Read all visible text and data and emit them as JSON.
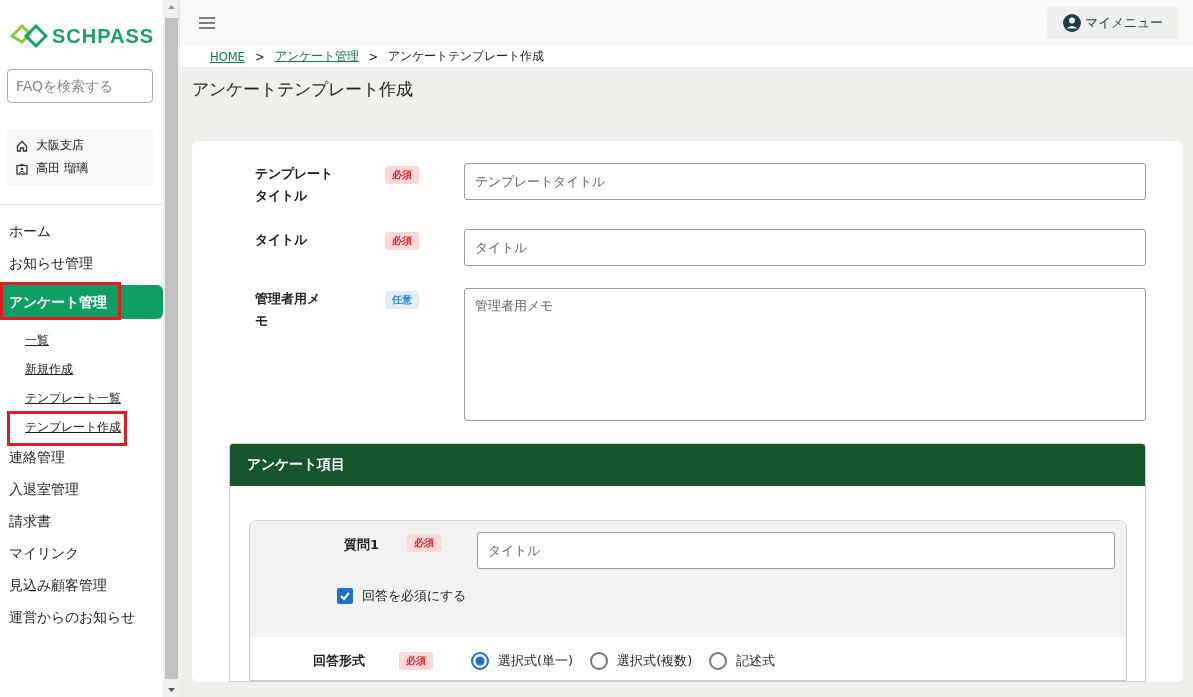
{
  "sidebar": {
    "logo": "SCHPASS",
    "search": {
      "placeholder": "FAQを検索する"
    },
    "user": {
      "branch": "大阪支店",
      "name": "高田 瑠璃"
    },
    "nav": [
      {
        "label": "ホーム",
        "selected": false,
        "highlighted": false
      },
      {
        "label": "お知らせ管理",
        "selected": false,
        "highlighted": false
      },
      {
        "label": "アンケート管理",
        "selected": true,
        "highlighted": true,
        "children": [
          {
            "label": "一覧",
            "highlighted": false
          },
          {
            "label": "新規作成",
            "highlighted": false
          },
          {
            "label": "テンプレート一覧",
            "highlighted": false
          },
          {
            "label": "テンプレート作成",
            "highlighted": true
          }
        ]
      },
      {
        "label": "連絡管理",
        "selected": false,
        "highlighted": false
      },
      {
        "label": "入退室管理",
        "selected": false,
        "highlighted": false
      },
      {
        "label": "請求書",
        "selected": false,
        "highlighted": false
      },
      {
        "label": "マイリンク",
        "selected": false,
        "highlighted": false
      },
      {
        "label": "見込み顧客管理",
        "selected": false,
        "highlighted": false
      },
      {
        "label": "運営からのお知らせ",
        "selected": false,
        "highlighted": false
      }
    ]
  },
  "header": {
    "my_menu": "マイメニュー"
  },
  "breadcrumb": [
    {
      "label": "HOME",
      "link": true
    },
    {
      "label": "アンケート管理",
      "link": true
    },
    {
      "label": "アンケートテンプレート作成",
      "link": false
    }
  ],
  "breadcrumb_separator": ">",
  "page_title": "アンケートテンプレート作成",
  "form": [
    {
      "label_lines": [
        "テンプレート",
        "タイトル"
      ],
      "badge": {
        "kind": "required",
        "text": "必須"
      },
      "kind": "input",
      "placeholder": "テンプレートタイトル"
    },
    {
      "label_lines": [
        "タイトル"
      ],
      "badge": {
        "kind": "required",
        "text": "必須"
      },
      "kind": "input",
      "placeholder": "タイトル"
    },
    {
      "label_lines": [
        "管理者用メ",
        "モ"
      ],
      "badge": {
        "kind": "optional",
        "text": "任意"
      },
      "kind": "textarea",
      "placeholder": "管理者用メモ"
    }
  ],
  "section": {
    "title": "アンケート項目",
    "question": {
      "label": "質問1",
      "badge": {
        "kind": "required",
        "text": "必須"
      },
      "placeholder": "タイトル",
      "required_checkbox": {
        "label": "回答を必須にする",
        "checked": true
      },
      "answer_format": {
        "label": "回答形式",
        "badge": {
          "kind": "required",
          "text": "必須"
        },
        "options": [
          {
            "label": "選択式(単一)",
            "selected": true
          },
          {
            "label": "選択式(複数)",
            "selected": false
          },
          {
            "label": "記述式",
            "selected": false
          }
        ]
      }
    }
  }
}
